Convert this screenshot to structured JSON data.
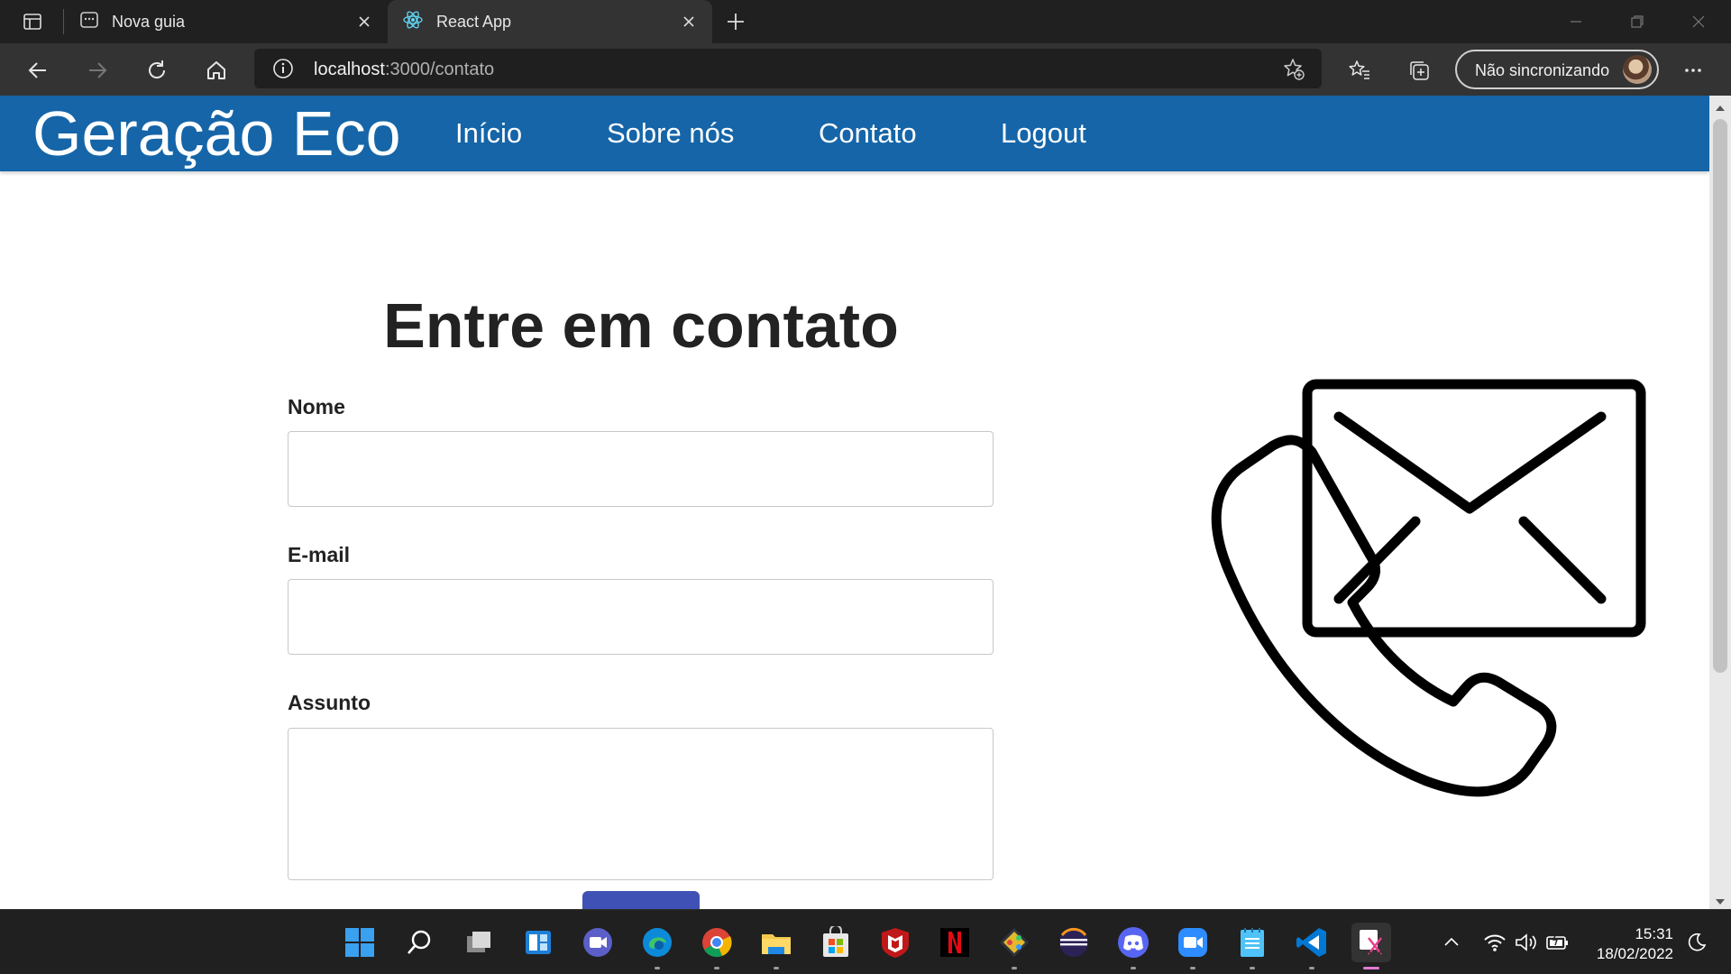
{
  "browser": {
    "tabs": [
      {
        "title": "Nova guia",
        "active": false
      },
      {
        "title": "React App",
        "active": true
      }
    ],
    "url_host": "localhost",
    "url_path": ":3000/contato",
    "profile_label": "Não sincronizando"
  },
  "site": {
    "brand": "Geração Eco",
    "nav": [
      "Início",
      "Sobre nós",
      "Contato",
      "Logout"
    ],
    "heading": "Entre em contato",
    "form": {
      "name_label": "Nome",
      "email_label": "E-mail",
      "subject_label": "Assunto",
      "name_value": "",
      "email_value": "",
      "subject_value": ""
    }
  },
  "taskbar": {
    "time": "15:31",
    "date": "18/02/2022"
  },
  "colors": {
    "navbar": "#1565a8",
    "submit_button": "#3f51b5"
  }
}
